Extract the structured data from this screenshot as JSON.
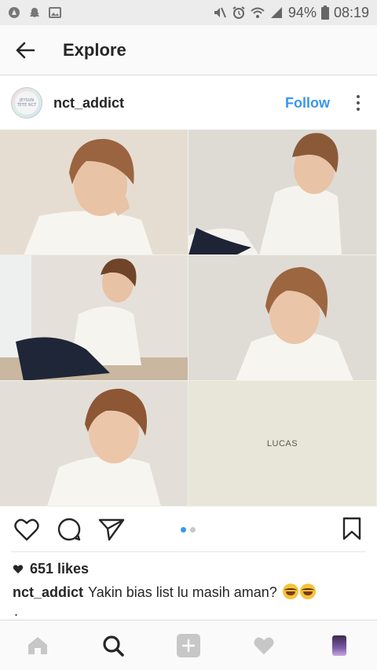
{
  "status_bar": {
    "battery": "94%",
    "time": "08:19"
  },
  "header": {
    "title": "Explore"
  },
  "post": {
    "username": "nct_addict",
    "follow_label": "Follow",
    "avatar_text": "JEYSUN TETE NCT",
    "grid_caption": "LUCAS",
    "likes": "651 likes",
    "caption_user": "nct_addict",
    "caption_text": "Yakin bias list lu masih aman?",
    "trailing": "."
  },
  "colors": {
    "accent": "#3897f0",
    "text": "#262626"
  }
}
